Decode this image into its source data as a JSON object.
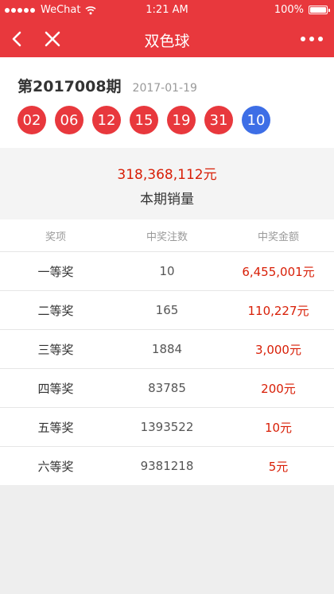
{
  "status_bar": {
    "carrier": "WeChat",
    "time": "1:21 AM",
    "battery": "100%"
  },
  "nav": {
    "title": "双色球"
  },
  "draw": {
    "issue": "第2017008期",
    "date": "2017-01-19",
    "red_balls": [
      "02",
      "06",
      "12",
      "15",
      "19",
      "31"
    ],
    "blue_ball": "10"
  },
  "sales": {
    "amount": "318,368,112元",
    "label": "本期销量"
  },
  "prize_table": {
    "headers": [
      "奖项",
      "中奖注数",
      "中奖金额"
    ],
    "rows": [
      {
        "level": "一等奖",
        "count": "10",
        "amount": "6,455,001元"
      },
      {
        "level": "二等奖",
        "count": "165",
        "amount": "110,227元"
      },
      {
        "level": "三等奖",
        "count": "1884",
        "amount": "3,000元"
      },
      {
        "level": "四等奖",
        "count": "83785",
        "amount": "200元"
      },
      {
        "level": "五等奖",
        "count": "1393522",
        "amount": "10元"
      },
      {
        "level": "六等奖",
        "count": "9381218",
        "amount": "5元"
      }
    ]
  },
  "colors": {
    "brand_red": "#e8383d",
    "amount_red": "#d81e06",
    "blue_ball": "#3d6ee6"
  }
}
